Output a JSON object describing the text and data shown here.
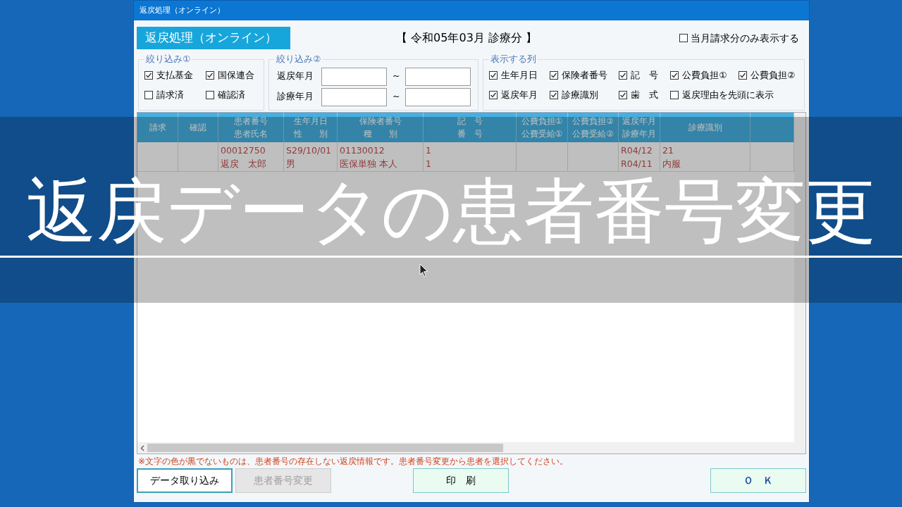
{
  "window": {
    "title": "返戻処理（オンライン）"
  },
  "header": {
    "badge": "返戻処理（オンライン）",
    "period": "【 令和05年03月 診療分 】",
    "month_only": {
      "label": "当月請求分のみ表示する",
      "checked": false
    }
  },
  "filter1": {
    "legend": "絞り込み①",
    "checkboxes": [
      {
        "label": "支払基金",
        "checked": true
      },
      {
        "label": "国保連合",
        "checked": true
      },
      {
        "label": "請求済",
        "checked": false
      },
      {
        "label": "確認済",
        "checked": false
      }
    ]
  },
  "filter2": {
    "legend": "絞り込み②",
    "rows": [
      {
        "label": "返戻年月",
        "separator": "~"
      },
      {
        "label": "診療年月",
        "separator": "~"
      }
    ]
  },
  "columns_filter": {
    "legend": "表示する列",
    "checkboxes": [
      {
        "label": "生年月日",
        "checked": true
      },
      {
        "label": "保険者番号",
        "checked": true
      },
      {
        "label": "記　号",
        "checked": true
      },
      {
        "label": "公費負担①",
        "checked": true
      },
      {
        "label": "公費負担②",
        "checked": true
      },
      {
        "label": "返戻年月",
        "checked": true
      },
      {
        "label": "診療識別",
        "checked": true
      },
      {
        "label": "歯　式",
        "checked": true
      },
      {
        "label": "返戻理由を先頭に表示",
        "checked": false
      }
    ]
  },
  "table": {
    "columns": [
      {
        "lines": [
          "請求"
        ]
      },
      {
        "lines": [
          "確認"
        ]
      },
      {
        "lines": [
          "患者番号",
          "患者氏名"
        ]
      },
      {
        "lines": [
          "生年月日",
          "性　　別"
        ]
      },
      {
        "lines": [
          "保険者番号",
          "種　　別"
        ]
      },
      {
        "lines": [
          "記　号",
          "番　号"
        ]
      },
      {
        "lines": [
          "公費負担①",
          "公費受給①"
        ]
      },
      {
        "lines": [
          "公費負担②",
          "公費受給②"
        ]
      },
      {
        "lines": [
          "返戻年月",
          "診療年月"
        ]
      },
      {
        "lines": [
          "診療識別"
        ]
      },
      {}
    ],
    "rows": [
      {
        "cells": [
          [],
          [],
          [
            "00012750",
            "返戻　太郎"
          ],
          [
            "S29/10/01",
            "男"
          ],
          [
            "01130012",
            "医保単独 本人"
          ],
          [
            "1",
            "1"
          ],
          [],
          [],
          [
            "R04/12",
            "R04/11"
          ],
          [
            "21",
            "内服"
          ],
          []
        ]
      }
    ]
  },
  "note": "※文字の色が黒でないものは、患者番号の存在しない返戻情報です。患者番号変更から患者を選択してください。",
  "buttons": [
    {
      "label": "データ取り込み",
      "disabled": false
    },
    {
      "label": "患者番号変更",
      "disabled": true
    },
    {
      "label": "印　刷",
      "disabled": false
    },
    {
      "label": "Ｏ　Ｋ",
      "disabled": false
    }
  ],
  "caption": "返戻データの患者番号変更"
}
